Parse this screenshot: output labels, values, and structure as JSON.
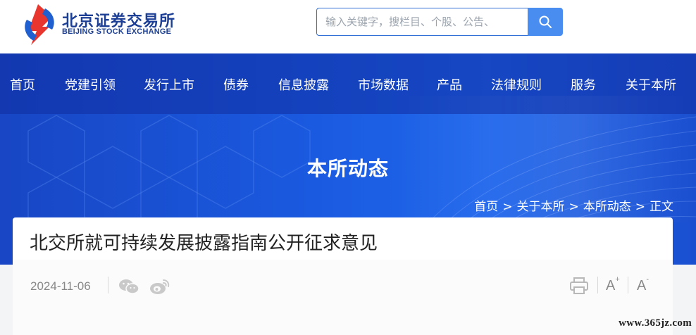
{
  "header": {
    "logo_cn": "北京证券交易所",
    "logo_en": "BEIJING STOCK EXCHANGE",
    "search_placeholder": "输入关键字，搜栏目、个股、公告、"
  },
  "nav": {
    "items": [
      "首页",
      "党建引领",
      "发行上市",
      "债券",
      "信息披露",
      "市场数据",
      "产品",
      "法律规则",
      "服务",
      "关于本所"
    ]
  },
  "hero": {
    "title": "本所动态"
  },
  "breadcrumb": {
    "items": [
      "首页",
      "关于本所",
      "本所动态",
      "正文"
    ],
    "separator": ">"
  },
  "article": {
    "title": "北交所就可持续发展披露指南公开征求意见",
    "date": "2024-11-06"
  },
  "tools": {
    "font_increase": "A",
    "font_increase_sup": "+",
    "font_decrease": "A",
    "font_decrease_sup": "-"
  },
  "watermark": "www.365jz.com",
  "colors": {
    "brand_blue": "#1c3f95",
    "hero_blue": "#1a5ae0",
    "logo_red": "#e8352e"
  }
}
